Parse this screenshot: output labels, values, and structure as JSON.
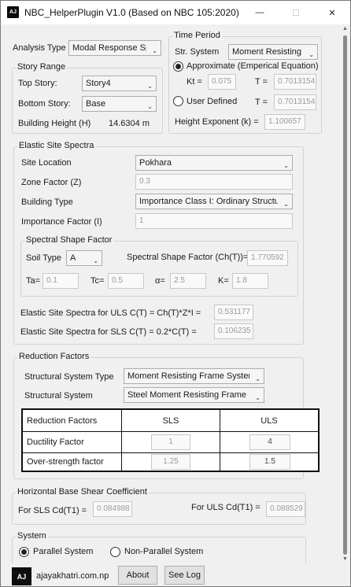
{
  "window": {
    "app_icon_text": "AJ",
    "title": "NBC_HelperPlugin V1.0 (Based on NBC 105:2020)",
    "minimize_glyph": "—",
    "maximize_glyph": "☐",
    "close_glyph": "✕"
  },
  "analysis": {
    "label": "Analysis Type",
    "value": "Modal Response Sp"
  },
  "story_range": {
    "title": "Story Range",
    "top_label": "Top Story:",
    "top_value": "Story4",
    "bottom_label": "Bottom Story:",
    "bottom_value": "Base",
    "height_label": "Building Height (H)",
    "height_value": "14.6304 m"
  },
  "time_period": {
    "title": "Time Period",
    "str_system_label": "Str. System",
    "str_system_value": "Moment Resisting C",
    "approx_label": "Approximate (Emperical Equation)",
    "kt_label": "Kt =",
    "kt_value": "0.075",
    "t_label": "T =",
    "t_value_1": "0.7013154",
    "user_defined_label": "User Defined",
    "t_value_2": "0.7013154",
    "height_exp_label": "Height Exponent (k) =",
    "height_exp_value": "1.100657"
  },
  "elastic": {
    "title": "Elastic Site Spectra",
    "site_label": "Site Location",
    "site_value": "Pokhara",
    "zone_label": "Zone Factor (Z)",
    "zone_value": "0.3",
    "building_label": "Building Type",
    "building_value": "Importance Class I: Ordinary Structu",
    "importance_label": "Importance Factor (I)",
    "importance_value": "1",
    "shape": {
      "title": "Spectral Shape Factor",
      "soil_label": "Soil Type",
      "soil_value": "A",
      "ssf_label": "Spectral Shape Factor (Ch(T))=",
      "ssf_value": "1.770592",
      "ta_label": "Ta=",
      "ta_value": "0.1",
      "tc_label": "Tc=",
      "tc_value": "0.5",
      "alpha_label": "α=",
      "alpha_value": "2.5",
      "k_label": "K=",
      "k_value": "1.8"
    },
    "uls_label": "Elastic Site Spectra for ULS C(T) = Ch(T)*Z*I =",
    "uls_value": "0.531177",
    "sls_label": "Elastic Site Spectra for SLS C(T) = 0.2*C(T) =",
    "sls_value": "0.106235"
  },
  "reduction": {
    "title": "Reduction Factors",
    "sst_label": "Structural System Type",
    "sst_value": "Moment Resisting Frame Syster",
    "ss_label": "Structural System",
    "ss_value": "Steel Moment Resisting Frame",
    "table": {
      "col0": "Reduction Factors",
      "col1": "SLS",
      "col2": "ULS",
      "rows": [
        {
          "name": "Ductility Factor",
          "sls": "1",
          "uls": "4"
        },
        {
          "name": "Over-strength factor",
          "sls": "1.25",
          "uls": "1.5"
        }
      ]
    }
  },
  "base_shear": {
    "title": "Horizontal Base Shear Coefficient",
    "sls_label": "For SLS Cd(T1) =",
    "sls_value": "0.084988",
    "uls_label": "For ULS Cd(T1) =",
    "uls_value": "0.088529"
  },
  "system": {
    "title": "System",
    "parallel_label": "Parallel System",
    "non_parallel_label": "Non-Parallel System"
  },
  "footer": {
    "logo_text": "AJ",
    "site": "ajayakhatri.com.np",
    "about_label": "About",
    "log_label": "See Log"
  }
}
